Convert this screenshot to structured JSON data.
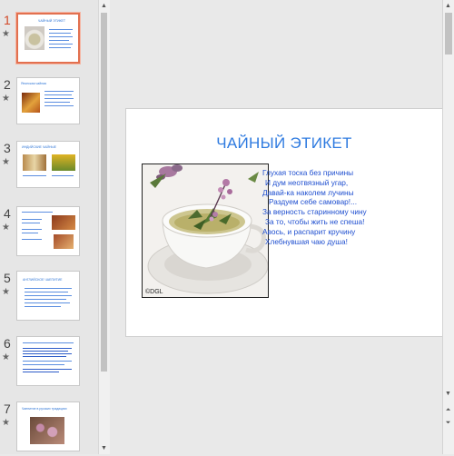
{
  "thumbnails": [
    {
      "number": "1",
      "title": "ЧАЙНЫЙ ЭТИКЕТ"
    },
    {
      "number": "2",
      "title": "Японская чайная"
    },
    {
      "number": "3",
      "title": "ИНДИЙСКИЕ ЧАЙНЫЕ"
    },
    {
      "number": "4",
      "title": ""
    },
    {
      "number": "5",
      "title": "АНГЛИЙСКОЕ ЧАЕПИТИЕ"
    },
    {
      "number": "6",
      "title": ""
    },
    {
      "number": "7",
      "title": "Чаепитие в русских традициях"
    }
  ],
  "slide": {
    "title": "ЧАЙНЫЙ ЭТИКЕТ",
    "photo_caption": "©DGL",
    "poem": [
      "Глухая тоска без причины",
      "И дум неотвязный угар,",
      "Давай-ка наколем лучины",
      "Раздуем себе самовар!...",
      "За верность старинному чину",
      "За то, чтобы жить не спеша!",
      "Авось, и распарит кручину",
      "Хлебнувшая чаю душа!"
    ]
  },
  "colors": {
    "accent": "#d24726",
    "title_blue": "#2f7be0",
    "text_blue": "#1f4fd0"
  },
  "icons": [
    "star-icon",
    "scroll-up-icon",
    "scroll-down-icon",
    "prev-slide-icon",
    "next-slide-icon"
  ]
}
